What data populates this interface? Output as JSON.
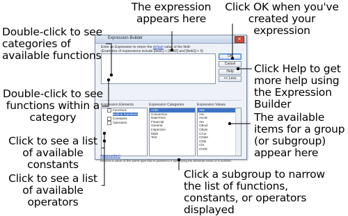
{
  "callouts": {
    "expression": "The expression appears here",
    "ok": "Click OK when you've created your expression",
    "categories_functions": "Double-click to see categories of available functions",
    "functions_in_category": "Double-click to see functions within a category",
    "constants": "Click to see a list of available constants",
    "operators": "Click to see a list of available operators",
    "help": "Click Help to get more help using the Expression Builder",
    "available_items": "The available items for a group (or subgroup) appear here",
    "subgroup": "Click a subgroup to narrow the list of functions, constants, or operators displayed"
  },
  "dialog": {
    "title": "Expression Builder",
    "instruction_prefix": "Enter an Expression to return the",
    "instruction_link": "default",
    "instruction_suffix": "value of the field:",
    "instruction_example": "(Examples of expressions include [field1] + [field2] and [field1] < 5)",
    "buttons": {
      "ok": "OK",
      "cancel": "Cancel",
      "help": "Help",
      "less": "<< Less"
    },
    "columns": {
      "elements": "Expression Elements",
      "categories": "Expression Categories",
      "values": "Expression Values"
    },
    "elements": [
      "Functions",
      "Built-In Functions",
      "Constants",
      "Operators"
    ],
    "categories": [
      "<All>",
      "Conversion",
      "Date/Time",
      "Financial",
      "General",
      "Inspection",
      "Math",
      "Text"
    ],
    "values": [
      "Abs",
      "Asc",
      "AscW",
      "Atn",
      "CBool",
      "CByte",
      "CCur",
      "CDate",
      "CDbl",
      "Chr",
      "ChrW"
    ],
    "help_link": "Abs(number)",
    "description": "Returns a value of the same type that is passed to it specifying the absolute value of a number."
  }
}
